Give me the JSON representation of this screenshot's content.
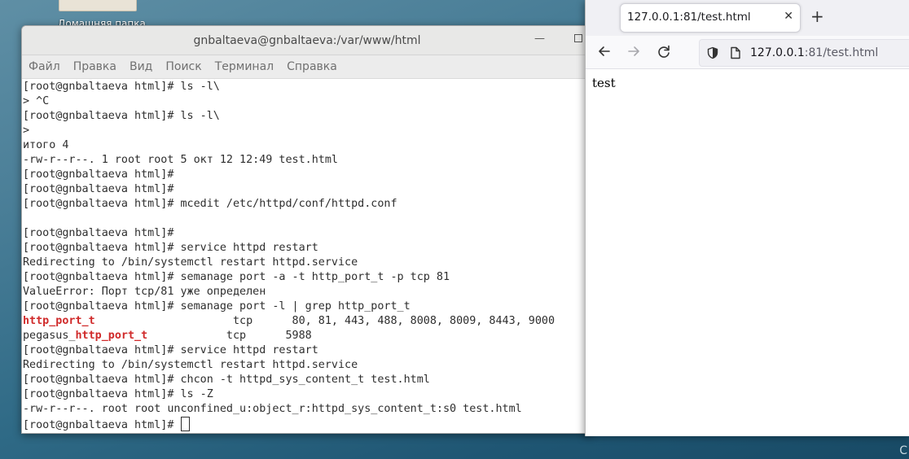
{
  "desktop": {
    "icon_label": "Домашняя папка"
  },
  "terminal": {
    "title": "gnbaltaeva@gnbaltaeva:/var/www/html",
    "menu": [
      "Файл",
      "Правка",
      "Вид",
      "Поиск",
      "Терминал",
      "Справка"
    ],
    "lines": [
      "[root@gnbaltaeva html]# ls -l\\",
      "> ^C",
      "[root@gnbaltaeva html]# ls -l\\",
      ">",
      "итого 4",
      "-rw-r--r--. 1 root root 5 окт 12 12:49 test.html",
      "[root@gnbaltaeva html]#",
      "[root@gnbaltaeva html]#",
      "[root@gnbaltaeva html]# mcedit /etc/httpd/conf/httpd.conf",
      "",
      "[root@gnbaltaeva html]#",
      "[root@gnbaltaeva html]# service httpd restart",
      "Redirecting to /bin/systemctl restart httpd.service",
      "[root@gnbaltaeva html]# semanage port -a -t http_port_t -p tcp 81",
      "ValueError: Порт tcp/81 уже определен",
      "[root@gnbaltaeva html]# semanage port -l | grep http_port_t"
    ],
    "grep_row1": {
      "match": "http_port_t",
      "rest": "                     tcp      80, 81, 443, 488, 8008, 8009, 8443, 9000"
    },
    "grep_row2": {
      "prefix": "pegasus_",
      "match": "http_port_t",
      "rest": "            tcp      5988"
    },
    "lines_after": [
      "[root@gnbaltaeva html]# service httpd restart",
      "Redirecting to /bin/systemctl restart httpd.service",
      "[root@gnbaltaeva html]# chcon -t httpd_sys_content_t test.html",
      "[root@gnbaltaeva html]# ls -Z",
      "-rw-r--r--. root root unconfined_u:object_r:httpd_sys_content_t:s0 test.html"
    ],
    "prompt": "[root@gnbaltaeva html]# "
  },
  "browser": {
    "tab_title": "127.0.0.1:81/test.html",
    "url_host": "127.0.0.1",
    "url_rest": ":81/test.html",
    "page_text": "test"
  },
  "colors": {
    "accent_red": "#d02a2a"
  }
}
